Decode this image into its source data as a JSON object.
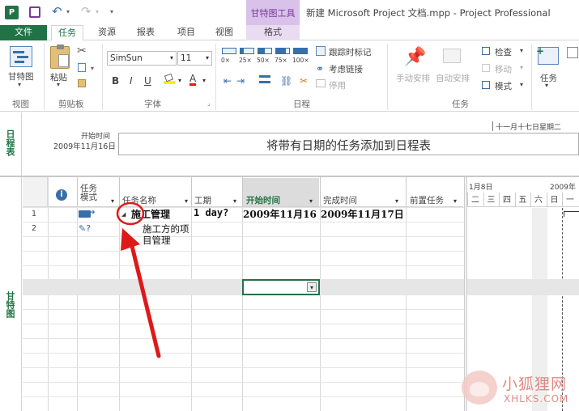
{
  "title_bar": {
    "app_icon": "project-app-icon",
    "tools_tab": "甘特图工具",
    "window_title": "新建 Microsoft Project 文档.mpp - Project Professional"
  },
  "tabs": {
    "file": "文件",
    "task": "任务",
    "resource": "资源",
    "report": "报表",
    "project": "项目",
    "view": "视图",
    "format": "格式"
  },
  "ribbon": {
    "view_group": {
      "gantt_label": "甘特图",
      "group_label": "视图"
    },
    "clipboard": {
      "paste_label": "粘贴",
      "group_label": "剪贴板"
    },
    "font": {
      "family": "SimSun",
      "size": "11",
      "group_label": "字体",
      "bold": "B",
      "italic": "I",
      "underline": "U",
      "font_color_letter": "A"
    },
    "schedule": {
      "pcts": [
        "0×",
        "25×",
        "50×",
        "75×",
        "100×"
      ],
      "mark_on_track": "跟踪时标记",
      "respect_links": "考虑链接",
      "inactivate": "停用",
      "group_label": "日程"
    },
    "tasks": {
      "manual": "手动安排",
      "auto": "自动安排",
      "inspect": "检查",
      "move": "移动",
      "mode": "模式",
      "group_label": "任务",
      "task_label": "任务"
    }
  },
  "timeline": {
    "side_label": "日程表",
    "start_label": "开始时间",
    "start_date": "2009年11月16日",
    "date_header": "十一月十七日星期二",
    "placeholder": "将带有日期的任务添加到日程表"
  },
  "grid": {
    "side_label": "甘特图",
    "columns": {
      "info": "i",
      "mode": "任务\n模式",
      "name": "任务名称",
      "duration": "工期",
      "start": "开始时间",
      "finish": "完成时间",
      "predecessors": "前置任务"
    },
    "rows": [
      {
        "id": "1",
        "name": "施工管理",
        "duration": "1 day?",
        "start": "2009年11月16",
        "finish": "2009年11月17日"
      },
      {
        "id": "2",
        "name": "施工方的项目管理",
        "duration": "",
        "start": "",
        "finish": ""
      }
    ],
    "gantt_header": {
      "week1": "1月8日",
      "week2": "2009年",
      "days": [
        "二",
        "三",
        "四",
        "五",
        "六",
        "日",
        "一"
      ]
    }
  },
  "watermark": {
    "cn": "小狐狸网",
    "en": "XHLKS.COM"
  },
  "colors": {
    "accent": "#217346",
    "tools": "#7a3a99",
    "highlight": "#dd1a1a"
  }
}
